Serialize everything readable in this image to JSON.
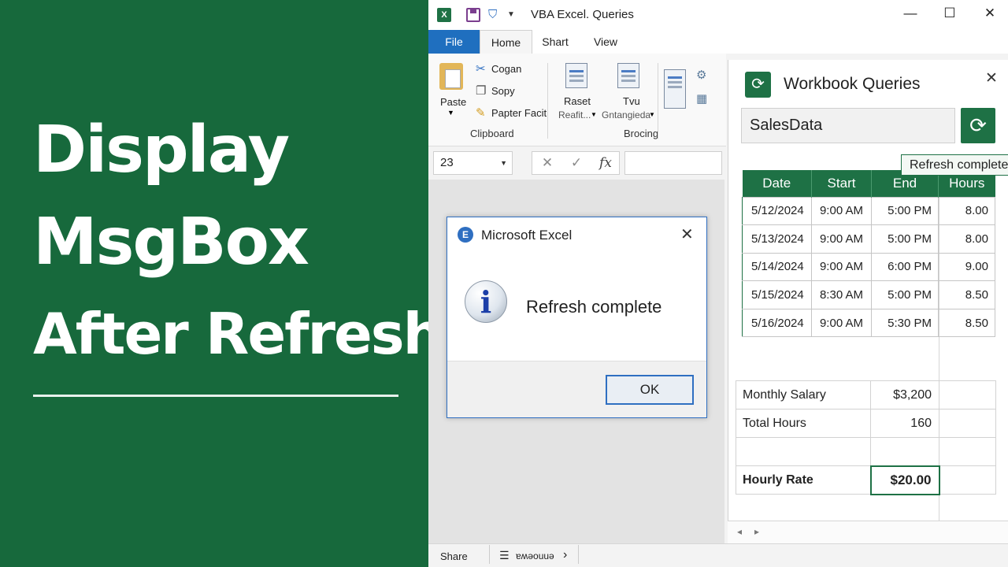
{
  "banner": {
    "line1": "Display",
    "line2": "MsgBox",
    "line3": "After Refresh",
    "background": "#17693c"
  },
  "window": {
    "title": "VBA Excel. Queries",
    "controls": {
      "minimize": "—",
      "maximize": "☐",
      "close": "✕"
    },
    "tabs": [
      "File",
      "Home",
      "Shart",
      "View"
    ]
  },
  "ribbon": {
    "paste_label": "Paste",
    "cut_label": "Cogan",
    "copy_label": "Sopy",
    "format_painter_label": "Papter Facit",
    "clipboard_group": "Clipboard",
    "raset_label": "Raset",
    "raset_sub": "Reafit...",
    "tvu_label": "Tvu",
    "tvu_sub": "Gntangieda",
    "brocing_group": "Brocing"
  },
  "formula_bar": {
    "name_box": "23",
    "cancel_icon": "✕",
    "enter_icon": "✓",
    "function_icon": "fx"
  },
  "status_bar": {
    "share_label": "Share",
    "sheet_label": "ɐʍǝouuǝ",
    "next_icon": "›"
  },
  "msgbox": {
    "title": "Microsoft Excel",
    "message": "Refresh complete",
    "ok_label": "OK",
    "close_icon": "✕",
    "info_icon_glyph": "i"
  },
  "queries_pane": {
    "title": "Workbook Queries",
    "query_name": "SalesData",
    "tooltip": "Refresh complete",
    "close_icon": "✕",
    "refresh_glyph": "⟳",
    "accent": "#1e7145",
    "table": {
      "headers": [
        "Date",
        "Start",
        "End",
        "Hours"
      ],
      "rows": [
        [
          "5/12/2024",
          "9:00 AM",
          "5:00 PM",
          "8.00"
        ],
        [
          "5/13/2024",
          "9:00 AM",
          "5:00 PM",
          "8.00"
        ],
        [
          "5/14/2024",
          "9:00 AM",
          "6:00 PM",
          "9.00"
        ],
        [
          "5/15/2024",
          "8:30 AM",
          "5:00 PM",
          "8.50"
        ],
        [
          "5/16/2024",
          "9:00 AM",
          "5:30 PM",
          "8.50"
        ]
      ]
    },
    "summary": {
      "monthly_salary_label": "Monthly Salary",
      "monthly_salary_value": "$3,200",
      "total_hours_label": "Total Hours",
      "total_hours_value": "160",
      "hourly_rate_label": "Hourly Rate",
      "hourly_rate_value": "$20.00"
    }
  },
  "pane_nav": {
    "left_icon": "◂",
    "right_icon": "▸"
  }
}
